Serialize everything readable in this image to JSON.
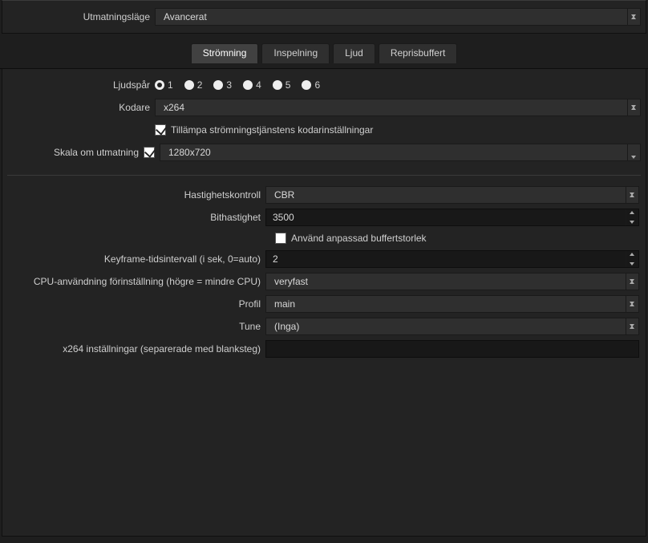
{
  "top": {
    "output_mode_label": "Utmatningsläge",
    "output_mode_value": "Avancerat"
  },
  "tabs": {
    "items": [
      {
        "label": "Strömning",
        "active": true
      },
      {
        "label": "Inspelning",
        "active": false
      },
      {
        "label": "Ljud",
        "active": false
      },
      {
        "label": "Reprisbuffert",
        "active": false
      }
    ]
  },
  "upper": {
    "audio_track_label": "Ljudspår",
    "audio_tracks": [
      "1",
      "2",
      "3",
      "4",
      "5",
      "6"
    ],
    "audio_tracks_selected": "1",
    "encoder_label": "Kodare",
    "encoder_value": "x264",
    "enforce_label": "Tillämpa strömningstjänstens kodarinställningar",
    "rescale_label": "Skala om utmatning",
    "rescale_value": "1280x720"
  },
  "encoder": {
    "rate_control_label": "Hastighetskontroll",
    "rate_control_value": "CBR",
    "bitrate_label": "Bithastighet",
    "bitrate_value": "3500",
    "custom_buffer_label": "Använd anpassad buffertstorlek",
    "keyframe_label": "Keyframe-tidsintervall (i sek, 0=auto)",
    "keyframe_value": "2",
    "cpu_preset_label": "CPU-användning förinställning (högre = mindre CPU)",
    "cpu_preset_value": "veryfast",
    "profile_label": "Profil",
    "profile_value": "main",
    "tune_label": "Tune",
    "tune_value": "(Inga)",
    "x264_opts_label": "x264 inställningar (separerade med blanksteg)",
    "x264_opts_value": ""
  }
}
